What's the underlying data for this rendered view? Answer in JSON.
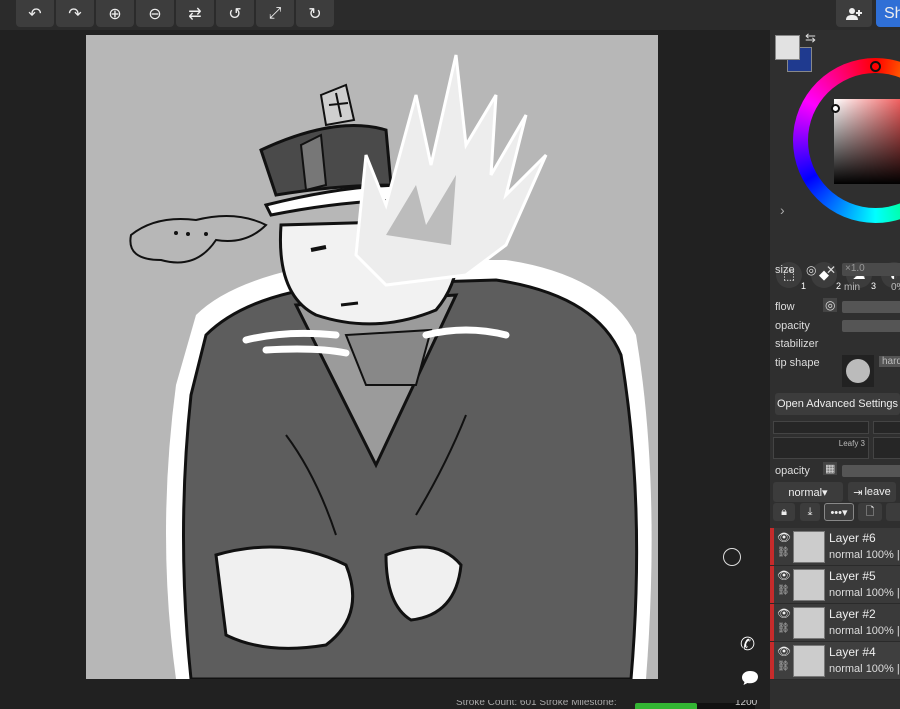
{
  "toolbar": {
    "buttons": [
      {
        "name": "undo-button",
        "icon": "undo-icon",
        "glyph": "↶"
      },
      {
        "name": "redo-button",
        "icon": "redo-icon",
        "glyph": "↷"
      },
      {
        "name": "zoom-in-button",
        "icon": "zoom-in-icon",
        "glyph": "⊕"
      },
      {
        "name": "zoom-out-button",
        "icon": "zoom-out-icon",
        "glyph": "⊖"
      },
      {
        "name": "flip-button",
        "icon": "flip-icon",
        "glyph": "⇄"
      },
      {
        "name": "rotate-left-button",
        "icon": "rotate-left-icon",
        "glyph": "↺"
      },
      {
        "name": "fit-button",
        "icon": "expand-icon",
        "glyph": "⤢"
      },
      {
        "name": "rotate-right-button",
        "icon": "rotate-right-icon",
        "glyph": "↻"
      }
    ],
    "share_label": "Sh",
    "add_user_icon": "add-user-icon"
  },
  "colors": {
    "primary": "#e2e2e2",
    "secondary": "#1f3a8f",
    "accent": "#2f6fd6",
    "layer_marker": "#c62b2b",
    "progress": "#33b533"
  },
  "brush": {
    "size_label": "size",
    "size_value": "×1.0",
    "min_label": "min",
    "min_value": "0%",
    "flow_label": "flow",
    "opacity_label": "opacity",
    "stabilizer_label": "stabilizer",
    "tip_shape_label": "tip shape",
    "tip_shape_value": "hard",
    "advanced_button": "Open Advanced Settings",
    "brush_preset": "Leafy 3",
    "tools": [
      {
        "icon": "transform-icon",
        "num": "1"
      },
      {
        "icon": "eraser-icon",
        "num": "2"
      },
      {
        "icon": "smudge-icon",
        "num": "3"
      },
      {
        "icon": "fill-icon",
        "num": ""
      }
    ]
  },
  "layers_panel": {
    "opacity_label": "opacity",
    "blend_mode": "normal▾",
    "leave_button": "leave",
    "layers": [
      {
        "name": "Layer #6",
        "mode": "normal",
        "opacity": "100%",
        "selected": false
      },
      {
        "name": "Layer #5",
        "mode": "normal",
        "opacity": "100%",
        "selected": false
      },
      {
        "name": "Layer #2",
        "mode": "normal",
        "opacity": "100%",
        "selected": false
      },
      {
        "name": "Layer #4",
        "mode": "normal",
        "opacity": "100%",
        "selected": true
      }
    ]
  },
  "status": {
    "text": "Stroke Count: 601   Stroke Milestone:",
    "progress_fraction": 0.52,
    "progress_value": "1200"
  }
}
